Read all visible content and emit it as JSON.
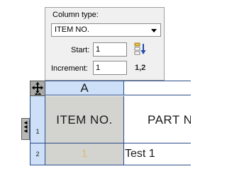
{
  "popup": {
    "title": "Column type:",
    "column_type_value": "ITEM NO.",
    "start_label": "Start:",
    "start_value": "1",
    "increment_label": "Increment:",
    "increment_value": "1",
    "sequence_label": "1,2",
    "order_icon": "sort-descending-icon"
  },
  "table": {
    "column_headers": [
      "A",
      ""
    ],
    "row_headers": [
      "1",
      "2"
    ],
    "rows": [
      [
        "ITEM NO.",
        "PART N"
      ],
      [
        "1",
        "Test 1"
      ]
    ],
    "move_icon": "move-arrows-icon",
    "row_marker_icon": "row-marker-icon",
    "header_color": "#cde0f7",
    "grid_color": "#2b4c8a",
    "shaded_cell_color": "#d3d3cf"
  }
}
